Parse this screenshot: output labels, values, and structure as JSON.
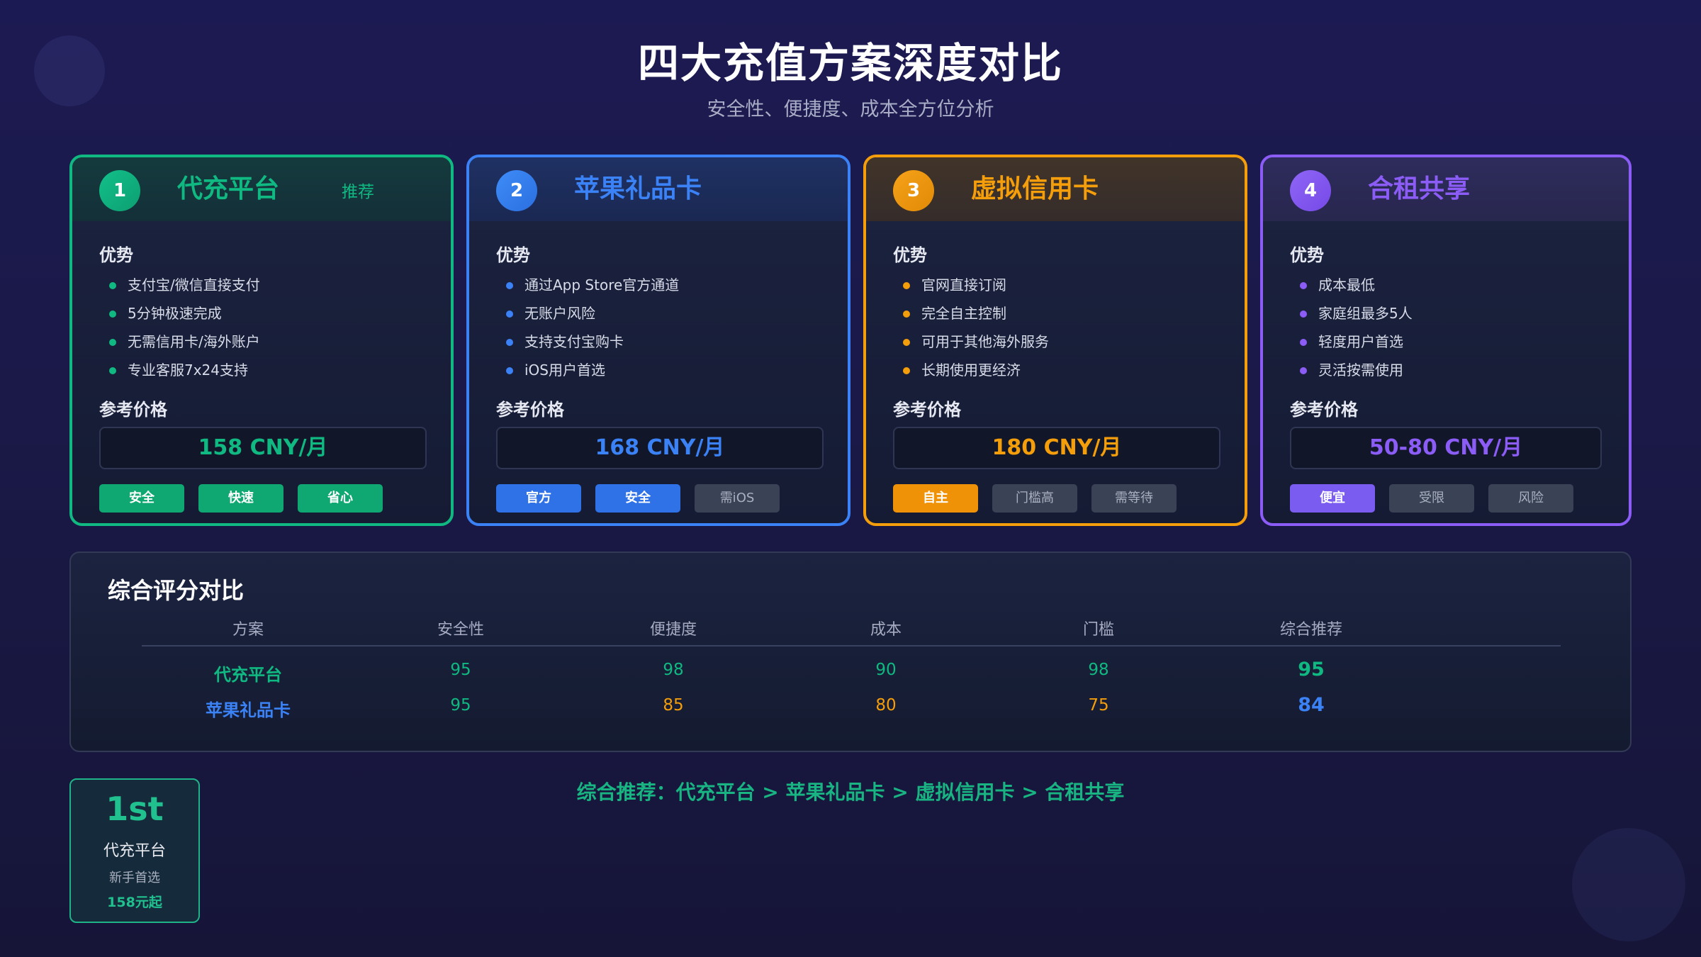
{
  "page": {
    "title": "四大充值方案深度对比",
    "subtitle": "安全性、便捷度、成本全方位分析"
  },
  "cards": [
    {
      "number": "1",
      "name": "代充平台",
      "tag": "推荐",
      "advantages_label": "优势",
      "advantages": [
        "支付宝/微信直接支付",
        "5分钟极速完成",
        "无需信用卡/海外账户",
        "专业客服7x24支持"
      ],
      "price_label": "参考价格",
      "price": "158 CNY/月",
      "chips": [
        "安全",
        "快速",
        "省心"
      ],
      "accent": "#10b981"
    },
    {
      "number": "2",
      "name": "苹果礼品卡",
      "tag": "",
      "advantages_label": "优势",
      "advantages": [
        "通过App Store官方通道",
        "无账户风险",
        "支持支付宝购卡",
        "iOS用户首选"
      ],
      "price_label": "参考价格",
      "price": "168 CNY/月",
      "chips": [
        "官方",
        "安全",
        "需iOS"
      ],
      "accent": "#3b82f6"
    },
    {
      "number": "3",
      "name": "虚拟信用卡",
      "tag": "",
      "advantages_label": "优势",
      "advantages": [
        "官网直接订阅",
        "完全自主控制",
        "可用于其他海外服务",
        "长期使用更经济"
      ],
      "price_label": "参考价格",
      "price": "180 CNY/月",
      "chips": [
        "自主",
        "门槛高",
        "需等待"
      ],
      "accent": "#f59e0b"
    },
    {
      "number": "4",
      "name": "合租共享",
      "tag": "",
      "advantages_label": "优势",
      "advantages": [
        "成本最低",
        "家庭组最多5人",
        "轻度用户首选",
        "灵活按需使用"
      ],
      "price_label": "参考价格",
      "price": "50-80 CNY/月",
      "chips": [
        "便宜",
        "受限",
        "风险"
      ],
      "accent": "#8b5cf6"
    }
  ],
  "score": {
    "title": "综合评分对比",
    "headers": [
      "方案",
      "安全性",
      "便捷度",
      "成本",
      "门槛",
      "综合推荐"
    ],
    "rows": [
      {
        "name": "代充平台",
        "values": [
          "95",
          "98",
          "90",
          "98"
        ],
        "total": "95"
      },
      {
        "name": "苹果礼品卡",
        "values": [
          "95",
          "85",
          "80",
          "75"
        ],
        "total": "84"
      }
    ]
  },
  "recommendation": "综合推荐：代充平台 > 苹果礼品卡 > 虚拟信用卡 > 合租共享",
  "rank_card": {
    "rank": "1st",
    "name": "代充平台",
    "note": "新手首选",
    "price": "158元起"
  },
  "colors": {
    "green": "#10b981",
    "blue": "#3b82f6",
    "orange": "#f59e0b",
    "purple": "#8b5cf6",
    "score_high": "#10b981",
    "score_mid": "#f59e0b"
  }
}
